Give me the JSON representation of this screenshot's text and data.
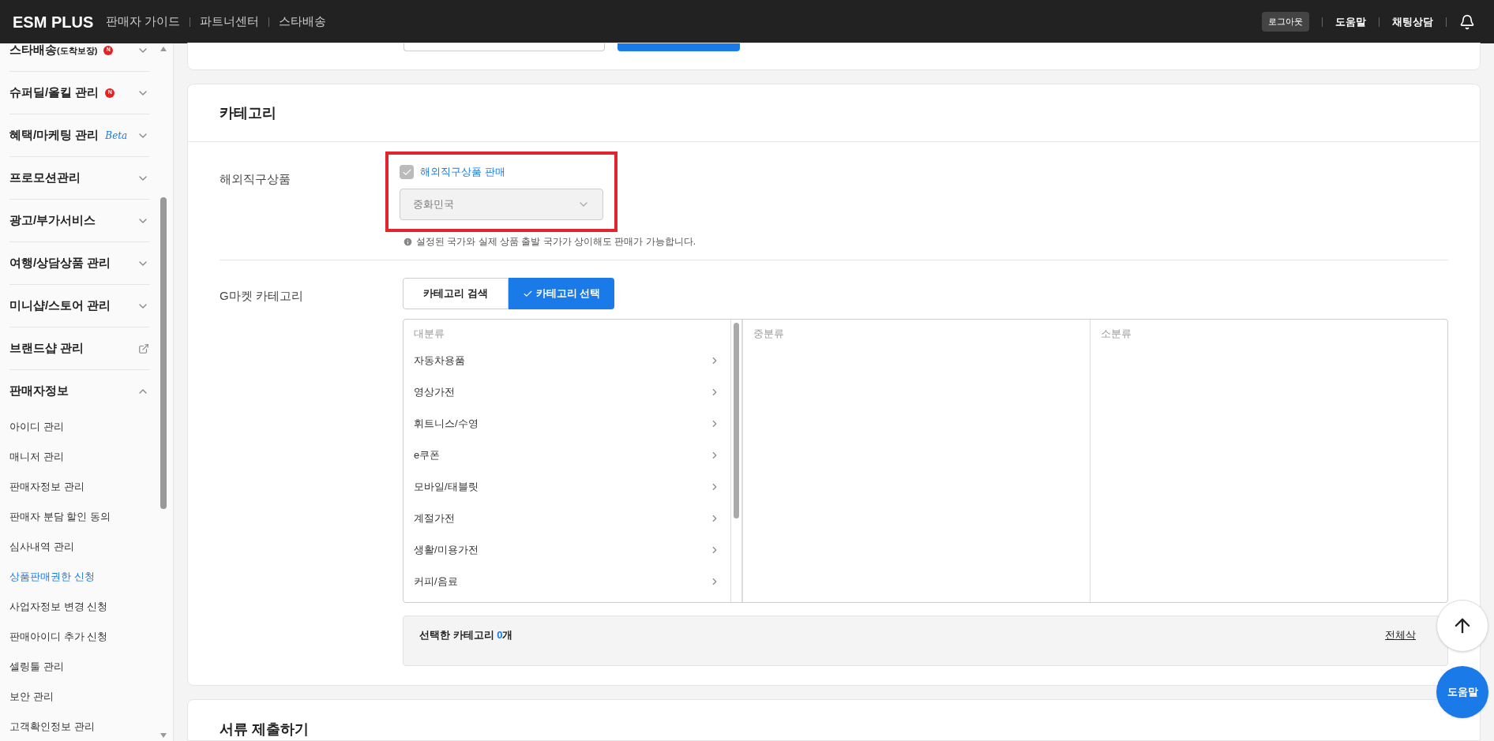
{
  "topbar": {
    "logo": "ESM PLUS",
    "links": [
      "판매자 가이드",
      "파트너센터",
      "스타배송"
    ],
    "logout": "로그아웃",
    "help": "도움말",
    "chat": "채팅상담"
  },
  "sidebar": {
    "menus": [
      {
        "label": "스타배송",
        "suffix": "(도착보장)",
        "badge": "N",
        "kind": "expand",
        "expanded": false
      },
      {
        "label": "슈퍼딜/올킬 관리",
        "badge": "N",
        "kind": "expand",
        "expanded": false
      },
      {
        "label": "혜택/마케팅 관리",
        "tag": "Beta",
        "kind": "expand",
        "expanded": false
      },
      {
        "label": "프로모션관리",
        "kind": "expand",
        "expanded": false
      },
      {
        "label": "광고/부가서비스",
        "kind": "expand",
        "expanded": false
      },
      {
        "label": "여행/상담상품 관리",
        "kind": "expand",
        "expanded": false
      },
      {
        "label": "미니샵/스토어 관리",
        "kind": "expand",
        "expanded": false
      },
      {
        "label": "브랜드샵 관리",
        "kind": "external"
      },
      {
        "label": "판매자정보",
        "kind": "expand",
        "expanded": true,
        "children": [
          {
            "label": "아이디 관리",
            "selected": false
          },
          {
            "label": "매니저 관리",
            "selected": false
          },
          {
            "label": "판매자정보 관리",
            "selected": false
          },
          {
            "label": "판매자 분담 할인 동의",
            "selected": false
          },
          {
            "label": "심사내역 관리",
            "selected": false
          },
          {
            "label": "상품판매권한 신청",
            "selected": true
          },
          {
            "label": "사업자정보 변경 신청",
            "selected": false
          },
          {
            "label": "판매아이디 추가 신청",
            "selected": false
          },
          {
            "label": "셀링툴 관리",
            "selected": false
          },
          {
            "label": "보안 관리",
            "selected": false
          },
          {
            "label": "고객확인정보 관리",
            "selected": false
          }
        ]
      }
    ]
  },
  "category_card": {
    "title": "카테고리",
    "overseas": {
      "label": "해외직구상품",
      "checkbox": {
        "label": "해외직구상품 판매",
        "checked": true,
        "disabled": true
      },
      "country": {
        "value": "중화민국",
        "disabled": true
      },
      "note": "설정된 국가와 실제 상품 출발 국가가 상이해도 판매가 가능합니다."
    },
    "gmarket": {
      "label": "G마켓 카테고리",
      "tabs": [
        {
          "label": "카테고리 검색",
          "selected": false
        },
        {
          "label": "카테고리 선택",
          "selected": true
        }
      ],
      "columns": [
        {
          "header": "대분류",
          "items": [
            "자동차용품",
            "영상가전",
            "휘트니스/수영",
            "e쿠폰",
            "모바일/태블릿",
            "계절가전",
            "생활/미용가전",
            "커피/음료"
          ]
        },
        {
          "header": "중분류"
        },
        {
          "header": "소분류"
        }
      ],
      "summary": {
        "label": "선택한 카테고리",
        "count": "0",
        "unit": "개",
        "clear": "전체삭"
      }
    }
  },
  "next_card": {
    "title": "서류 제출하기"
  },
  "floating": {
    "help": "도움말"
  }
}
